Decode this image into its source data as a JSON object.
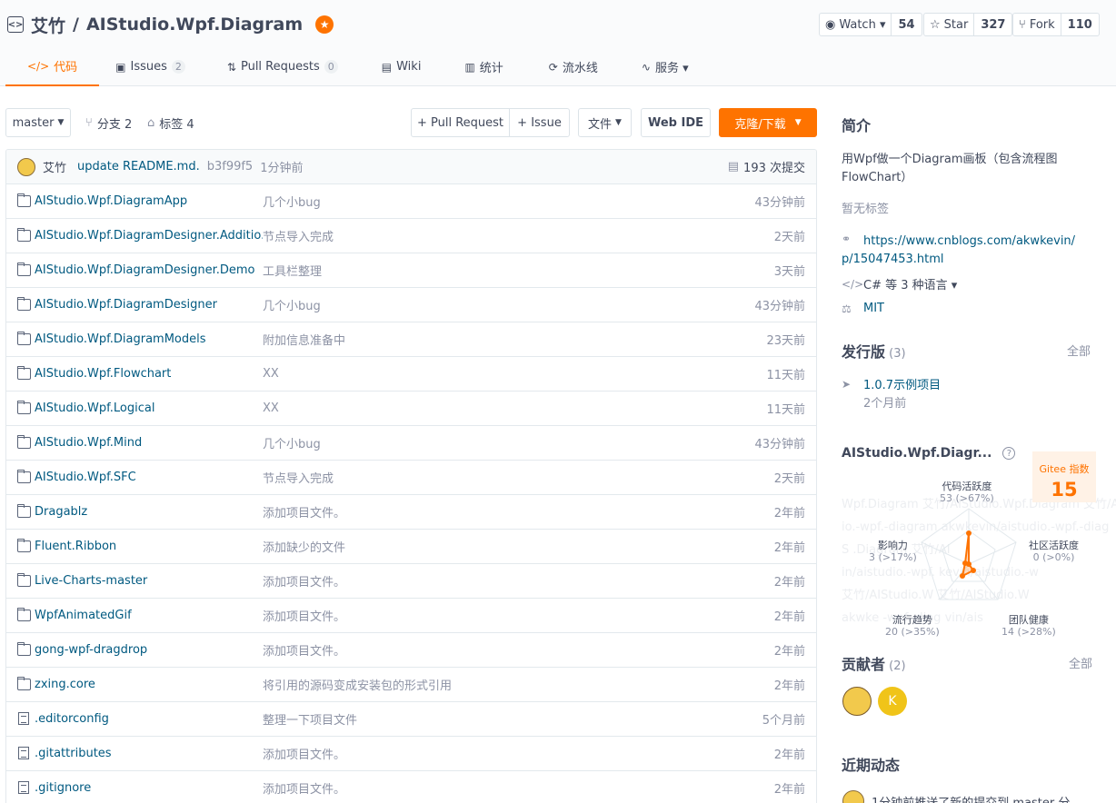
{
  "repo": {
    "owner": "艾竹",
    "sep": "/",
    "name": "AIStudio.Wpf.Diagram"
  },
  "actions": {
    "watch": {
      "label": "Watch ▾",
      "count": "54"
    },
    "star": {
      "label": "Star",
      "count": "327"
    },
    "fork": {
      "label": "Fork",
      "count": "110"
    }
  },
  "tabs": [
    {
      "label": "代码",
      "icon": "</>"
    },
    {
      "label": "Issues",
      "icon": "▣",
      "count": "2"
    },
    {
      "label": "Pull Requests",
      "icon": "⇅",
      "count": "0"
    },
    {
      "label": "Wiki",
      "icon": "▤"
    },
    {
      "label": "统计",
      "icon": "▥"
    },
    {
      "label": "流水线",
      "icon": "⟳"
    },
    {
      "label": "服务 ▾",
      "icon": "∿"
    }
  ],
  "toolbar": {
    "branch": "master",
    "branches": "分支 2",
    "tags": "标签 4",
    "pull_request": "+ Pull Request",
    "issue": "+ Issue",
    "files": "文件",
    "web_ide": "Web IDE",
    "clone": "克隆/下载"
  },
  "last_commit": {
    "author": "艾竹",
    "message": "update README.md.",
    "hash": "b3f99f5",
    "time": "1分钟前",
    "total": "193 次提交"
  },
  "files": [
    {
      "type": "folder",
      "name": "AIStudio.Wpf.DiagramApp",
      "message": "几个小bug",
      "time": "43分钟前"
    },
    {
      "type": "folder",
      "name": "AIStudio.Wpf.DiagramDesigner.Additio...",
      "message": "节点导入完成",
      "time": "2天前"
    },
    {
      "type": "folder",
      "name": "AIStudio.Wpf.DiagramDesigner.Demo",
      "message": "工具栏整理",
      "time": "3天前"
    },
    {
      "type": "folder",
      "name": "AIStudio.Wpf.DiagramDesigner",
      "message": "几个小bug",
      "time": "43分钟前"
    },
    {
      "type": "folder",
      "name": "AIStudio.Wpf.DiagramModels",
      "message": "附加信息准备中",
      "time": "23天前"
    },
    {
      "type": "folder",
      "name": "AIStudio.Wpf.Flowchart",
      "message": "XX",
      "time": "11天前"
    },
    {
      "type": "folder",
      "name": "AIStudio.Wpf.Logical",
      "message": "XX",
      "time": "11天前"
    },
    {
      "type": "folder",
      "name": "AIStudio.Wpf.Mind",
      "message": "几个小bug",
      "time": "43分钟前"
    },
    {
      "type": "folder",
      "name": "AIStudio.Wpf.SFC",
      "message": "节点导入完成",
      "time": "2天前"
    },
    {
      "type": "folder",
      "name": "Dragablz",
      "message": "添加项目文件。",
      "time": "2年前"
    },
    {
      "type": "folder",
      "name": "Fluent.Ribbon",
      "message": "添加缺少的文件",
      "time": "2年前"
    },
    {
      "type": "folder",
      "name": "Live-Charts-master",
      "message": "添加项目文件。",
      "time": "2年前"
    },
    {
      "type": "folder",
      "name": "WpfAnimatedGif",
      "message": "添加项目文件。",
      "time": "2年前"
    },
    {
      "type": "folder",
      "name": "gong-wpf-dragdrop",
      "message": "添加项目文件。",
      "time": "2年前"
    },
    {
      "type": "folder",
      "name": "zxing.core",
      "message": "将引用的源码变成安装包的形式引用",
      "time": "2年前"
    },
    {
      "type": "file",
      "name": ".editorconfig",
      "message": "整理一下项目文件",
      "time": "5个月前"
    },
    {
      "type": "file",
      "name": ".gitattributes",
      "message": "添加项目文件。",
      "time": "2年前"
    },
    {
      "type": "file",
      "name": ".gitignore",
      "message": "添加项目文件。",
      "time": "2年前"
    }
  ],
  "sidebar": {
    "intro_title": "简介",
    "description": "用Wpf做一个Diagram画板（包含流程图FlowChart）",
    "no_tags": "暂无标签",
    "link": "https://www.cnblogs.com/akwkevin/p/15047453.html",
    "languages": "C# 等 3 种语言 ▾",
    "license": "MIT",
    "releases_title": "发行版",
    "releases_count": "(3)",
    "releases_all": "全部",
    "release_name": "1.0.7示例项目",
    "release_time": "2个月前",
    "index_title": "AIStudio.Wpf.Diagr...",
    "gitee_label": "Gitee 指数",
    "gitee_value": "15",
    "radar": {
      "code": {
        "label": "代码活跃度",
        "value": "53 (>67%)"
      },
      "community": {
        "label": "社区活跃度",
        "value": "0 (>0%)"
      },
      "team": {
        "label": "团队健康",
        "value": "14 (>28%)"
      },
      "trend": {
        "label": "流行趋势",
        "value": "20 (>35%)"
      },
      "impact": {
        "label": "影响力",
        "value": "3 (>17%)"
      }
    },
    "contributors_title": "贡献者",
    "contributors_count": "(2)",
    "contributors_all": "全部",
    "contributor_k": "K",
    "activity_title": "近期动态",
    "activity_text": "1分钟前推送了新的提交到 master 分"
  }
}
